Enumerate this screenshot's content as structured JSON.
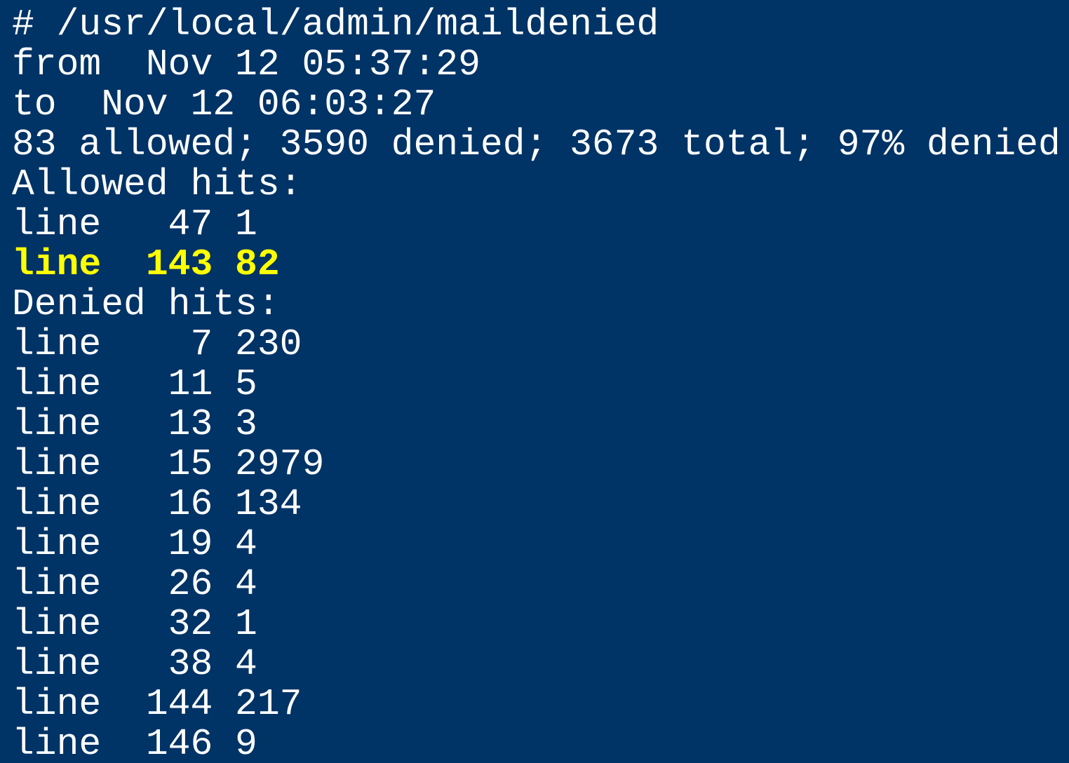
{
  "terminal": {
    "background_color": "#003366",
    "text_color": "#ffffff",
    "highlight_color": "#ffff00",
    "lines": [
      {
        "text": "# /usr/local/admin/maildenied",
        "highlight": false
      },
      {
        "text": "from  Nov 12 05:37:29",
        "highlight": false
      },
      {
        "text": "to  Nov 12 06:03:27",
        "highlight": false
      },
      {
        "text": "83 allowed; 3590 denied; 3673 total; 97% denied",
        "highlight": false
      },
      {
        "text": "Allowed hits:",
        "highlight": false
      },
      {
        "text": "line   47 1",
        "highlight": false
      },
      {
        "text": "line  143 82",
        "highlight": true
      },
      {
        "text": "Denied hits:",
        "highlight": false
      },
      {
        "text": "line    7 230",
        "highlight": false
      },
      {
        "text": "line   11 5",
        "highlight": false
      },
      {
        "text": "line   13 3",
        "highlight": false
      },
      {
        "text": "line   15 2979",
        "highlight": false
      },
      {
        "text": "line   16 134",
        "highlight": false
      },
      {
        "text": "line   19 4",
        "highlight": false
      },
      {
        "text": "line   26 4",
        "highlight": false
      },
      {
        "text": "line   32 1",
        "highlight": false
      },
      {
        "text": "line   38 4",
        "highlight": false
      },
      {
        "text": "line  144 217",
        "highlight": false
      },
      {
        "text": "line  146 9",
        "highlight": false
      }
    ]
  }
}
